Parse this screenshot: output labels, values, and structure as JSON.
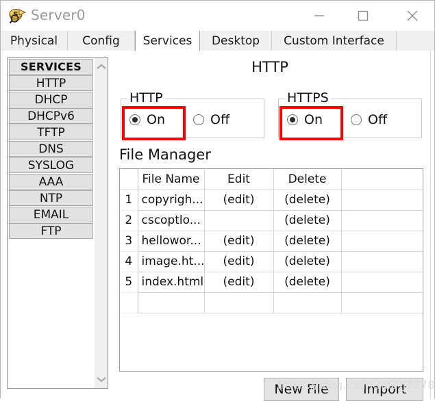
{
  "window": {
    "title": "Server0",
    "icon": "server-device-icon",
    "controls": {
      "minimize": "minimize-icon",
      "maximize": "maximize-icon",
      "close": "close-icon"
    }
  },
  "tabs": [
    {
      "label": "Physical",
      "active": false
    },
    {
      "label": "Config",
      "active": false
    },
    {
      "label": "Services",
      "active": true
    },
    {
      "label": "Desktop",
      "active": false
    },
    {
      "label": "Custom Interface",
      "active": false
    }
  ],
  "sidebar": {
    "header": "SERVICES",
    "items": [
      {
        "label": "HTTP"
      },
      {
        "label": "DHCP"
      },
      {
        "label": "DHCPv6"
      },
      {
        "label": "TFTP"
      },
      {
        "label": "DNS"
      },
      {
        "label": "SYSLOG"
      },
      {
        "label": "AAA"
      },
      {
        "label": "NTP"
      },
      {
        "label": "EMAIL"
      },
      {
        "label": "FTP"
      }
    ],
    "scroll_up_icon": "chevron-up-icon",
    "scroll_down_icon": "chevron-down-icon"
  },
  "main": {
    "page_title": "HTTP",
    "http_group": {
      "legend": "HTTP",
      "on_label": "On",
      "off_label": "Off",
      "selected": "On",
      "highlighted": true
    },
    "https_group": {
      "legend": "HTTPS",
      "on_label": "On",
      "off_label": "Off",
      "selected": "On",
      "highlighted": true
    },
    "file_manager": {
      "title": "File Manager",
      "columns": [
        "",
        "File Name",
        "Edit",
        "Delete",
        ""
      ],
      "rows": [
        {
          "num": "1",
          "name": "copyrigh...",
          "edit": "(edit)",
          "delete": "(delete)"
        },
        {
          "num": "2",
          "name": "cscoptlo...",
          "edit": "",
          "delete": "(delete)"
        },
        {
          "num": "3",
          "name": "hellowor...",
          "edit": "(edit)",
          "delete": "(delete)"
        },
        {
          "num": "4",
          "name": "image.ht...",
          "edit": "(edit)",
          "delete": "(delete)"
        },
        {
          "num": "5",
          "name": "index.html",
          "edit": "(edit)",
          "delete": "(delete)"
        }
      ]
    },
    "buttons": {
      "new_file": "New File",
      "import": "Import"
    }
  },
  "watermark": "https://blog.csdn.net/JJ7778",
  "colors": {
    "highlight": "#fe0000",
    "active_tab_bg": "#ffffff",
    "tab_bg": "#f0f0f0",
    "sidebar_item_bg": "#e2e2e2",
    "button_bg": "#e3e3e3",
    "title_text": "#9a9a9a"
  }
}
